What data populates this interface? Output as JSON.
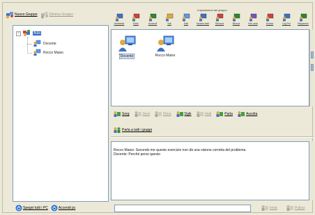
{
  "left_toolbar": {
    "new_group": "Nuovo Gruppo",
    "delete_group": "Elimina Gruppo"
  },
  "tree": {
    "root": "Aula",
    "children": [
      "Docente",
      "Rocco Maiso"
    ]
  },
  "left_bottom": {
    "shutdown_all": "Spegni tutti i PC",
    "power_on": "Accendi pc"
  },
  "top_toolbar": {
    "title": "Impostazioni del gruppo",
    "tools": [
      {
        "label": "Ambiente",
        "icon": "computer-icon"
      },
      {
        "label": "Esito",
        "icon": "computer-icon"
      },
      {
        "label": "Accendi",
        "icon": "computer-icon"
      },
      {
        "label": "Voti",
        "icon": "computer-icon"
      },
      {
        "label": "Dati",
        "icon": "computer-icon"
      },
      {
        "label": "Mostra esiti",
        "icon": "globe-icon"
      },
      {
        "label": "Sblocca",
        "icon": "globe-icon"
      },
      {
        "label": "Blocca",
        "icon": "globe-icon"
      },
      {
        "label": "Info aula",
        "icon": "info-icon"
      },
      {
        "label": "Avvisa",
        "icon": "computer-icon"
      },
      {
        "label": "Log Pro",
        "icon": "computer-icon"
      },
      {
        "label": "Risparmio",
        "icon": "computer-icon"
      }
    ]
  },
  "pc_view": {
    "items": [
      "Docente",
      "Rocco Maiso"
    ]
  },
  "actions": {
    "row1": [
      {
        "label": "Sorg",
        "enabled": true
      },
      {
        "label": "Dest",
        "enabled": false
      },
      {
        "label": "Dimo",
        "enabled": false
      },
      {
        "label": "Dgik",
        "enabled": true
      },
      {
        "label": "Vedi",
        "enabled": false
      },
      {
        "label": "Parla",
        "enabled": true
      },
      {
        "label": "Ascolta",
        "enabled": true
      }
    ],
    "all": "Parla a tutti i gruppi"
  },
  "chat": {
    "lines": [
      "Rocco Maiso: Secondo me questo esercizio non dà una visione corretta del problema",
      "Docente: Perché pensi questo"
    ]
  },
  "input": {
    "value": "",
    "send": "Invia",
    "clear": "Pulisci"
  },
  "colors": {
    "selection": "#316ac5",
    "border": "#7f9db9",
    "background": "#ece9d8"
  }
}
